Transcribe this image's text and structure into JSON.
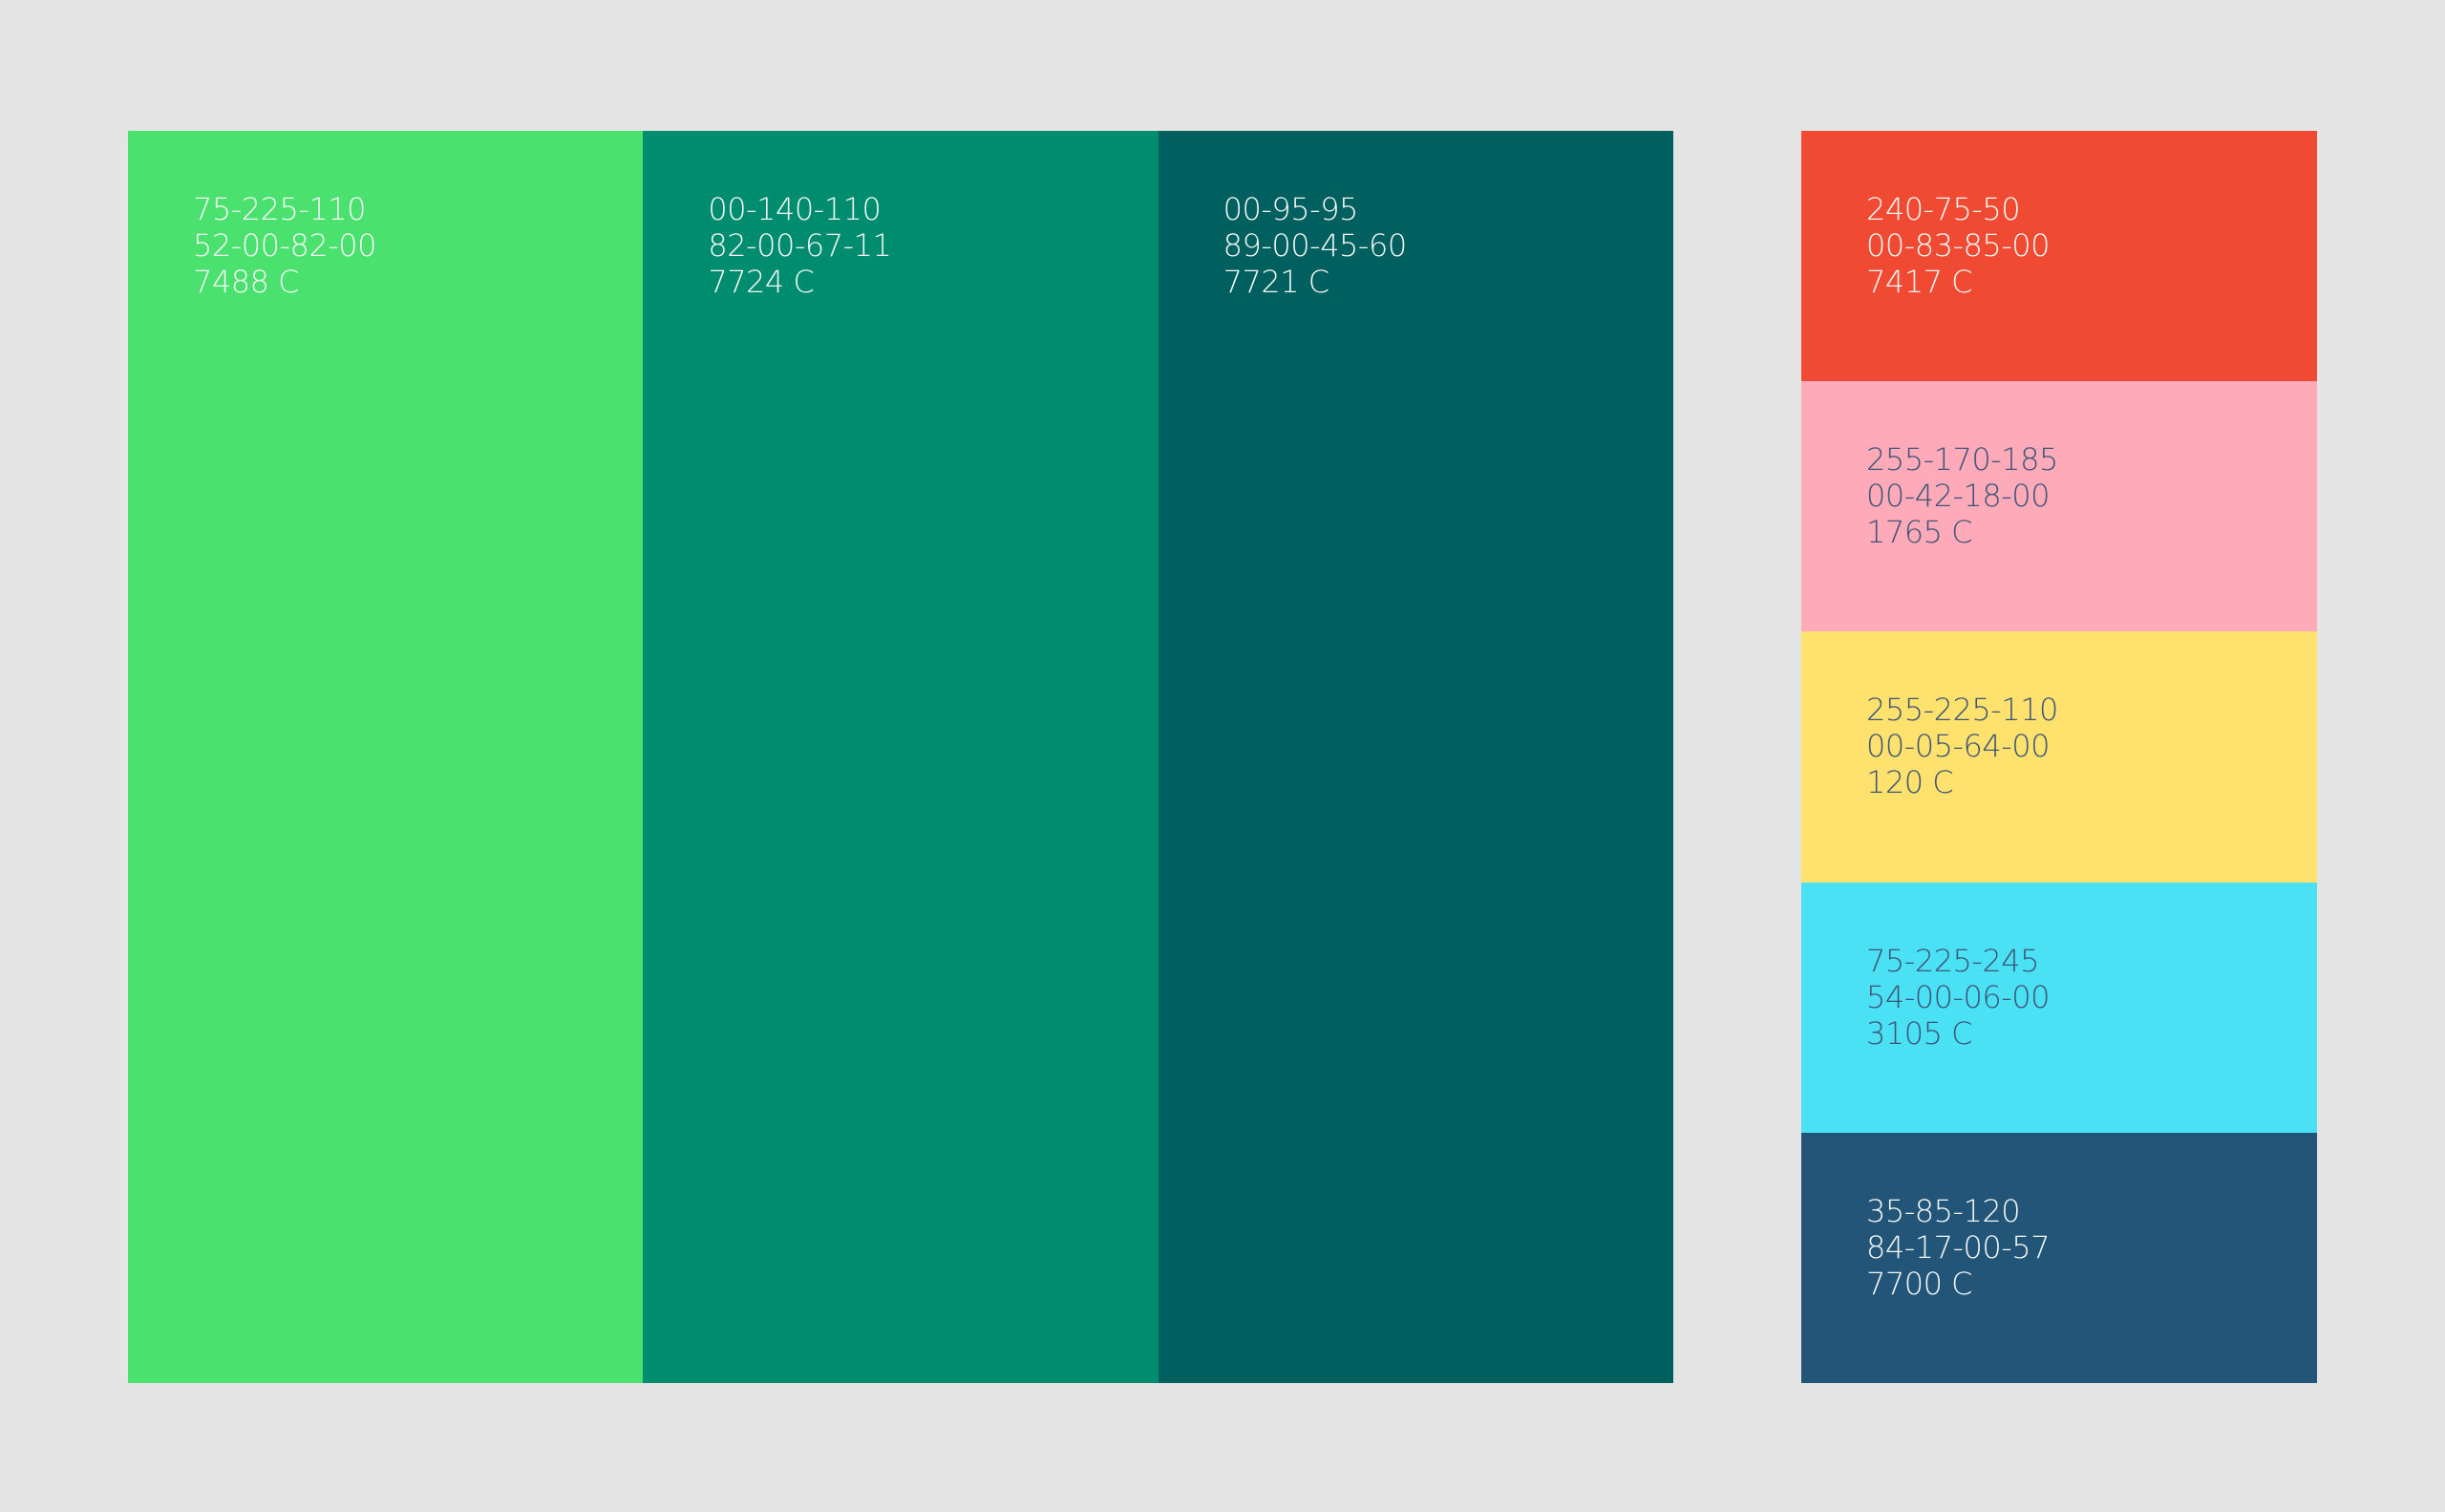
{
  "primary_palette": [
    {
      "name": "green",
      "color": "#4be16e",
      "rgb": "75-225-110",
      "cmyk": "52-00-82-00",
      "pantone": "7488 C",
      "text_tone": "light"
    },
    {
      "name": "teal",
      "color": "#008c6e",
      "rgb": "00-140-110",
      "cmyk": "82-00-67-11",
      "pantone": "7724 C",
      "text_tone": "light"
    },
    {
      "name": "dark-teal",
      "color": "#005f5f",
      "rgb": "00-95-95",
      "cmyk": "89-00-45-60",
      "pantone": "7721 C",
      "text_tone": "light"
    }
  ],
  "secondary_palette": [
    {
      "name": "red",
      "color": "#f04b32",
      "rgb": "240-75-50",
      "cmyk": "00-83-85-00",
      "pantone": "7417 C",
      "text_tone": "light"
    },
    {
      "name": "pink",
      "color": "#ffaab9",
      "rgb": "255-170-185",
      "cmyk": "00-42-18-00",
      "pantone": "1765 C",
      "text_tone": "dark"
    },
    {
      "name": "yellow",
      "color": "#ffe16e",
      "rgb": "255-225-110",
      "cmyk": "00-05-64-00",
      "pantone": "120 C",
      "text_tone": "dark"
    },
    {
      "name": "cyan",
      "color": "#4be1f5",
      "rgb": "75-225-245",
      "cmyk": "54-00-06-00",
      "pantone": "3105 C",
      "text_tone": "dark"
    },
    {
      "name": "navy",
      "color": "#235578",
      "rgb": "35-85-120",
      "cmyk": "84-17-00-57",
      "pantone": "7700 C",
      "text_tone": "light"
    }
  ]
}
